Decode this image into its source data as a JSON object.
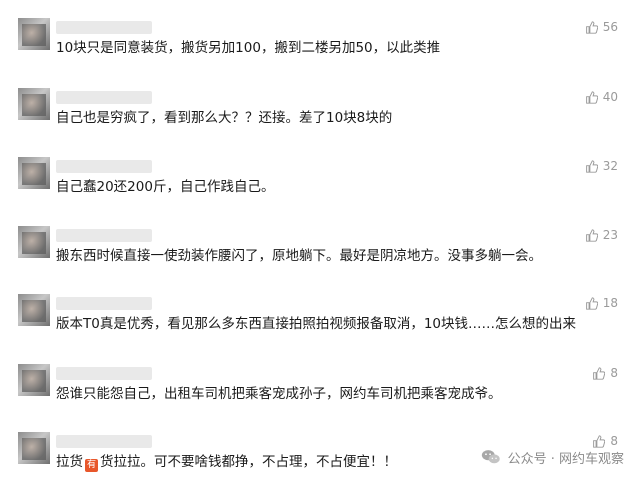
{
  "comments": [
    {
      "text": "10块只是同意装货，搬货另加100，搬到二楼另加50，以此类推",
      "likes": "56"
    },
    {
      "text": "自己也是穷疯了，看到那么大？？还接。差了10块8块的",
      "likes": "40"
    },
    {
      "text": "自己蠢20还200斤，自己作践自己。",
      "likes": "32"
    },
    {
      "text": "搬东西时候直接一使劲装作腰闪了，原地躺下。最好是阴凉地方。没事多躺一会。",
      "likes": "23"
    },
    {
      "text": "版本T0真是优秀，看见那么多东西直接拍照拍视频报备取消，10块钱……怎么想的出来",
      "likes": "18"
    },
    {
      "text": "怨谁只能怨自己，出租车司机把乘客宠成孙子，网约车司机把乘客宠成爷。",
      "likes": "8"
    },
    {
      "text_before": "拉货",
      "badge": "有",
      "text_after": "货拉拉。可不要啥钱都挣，不占理，不占便宜！！",
      "likes": "8"
    }
  ],
  "watermark": {
    "text": "公众号 · 网约车观察",
    "icon": "wechat-icon"
  },
  "colors": {
    "like": "#9a9a9a",
    "badge": "#e8572b"
  }
}
